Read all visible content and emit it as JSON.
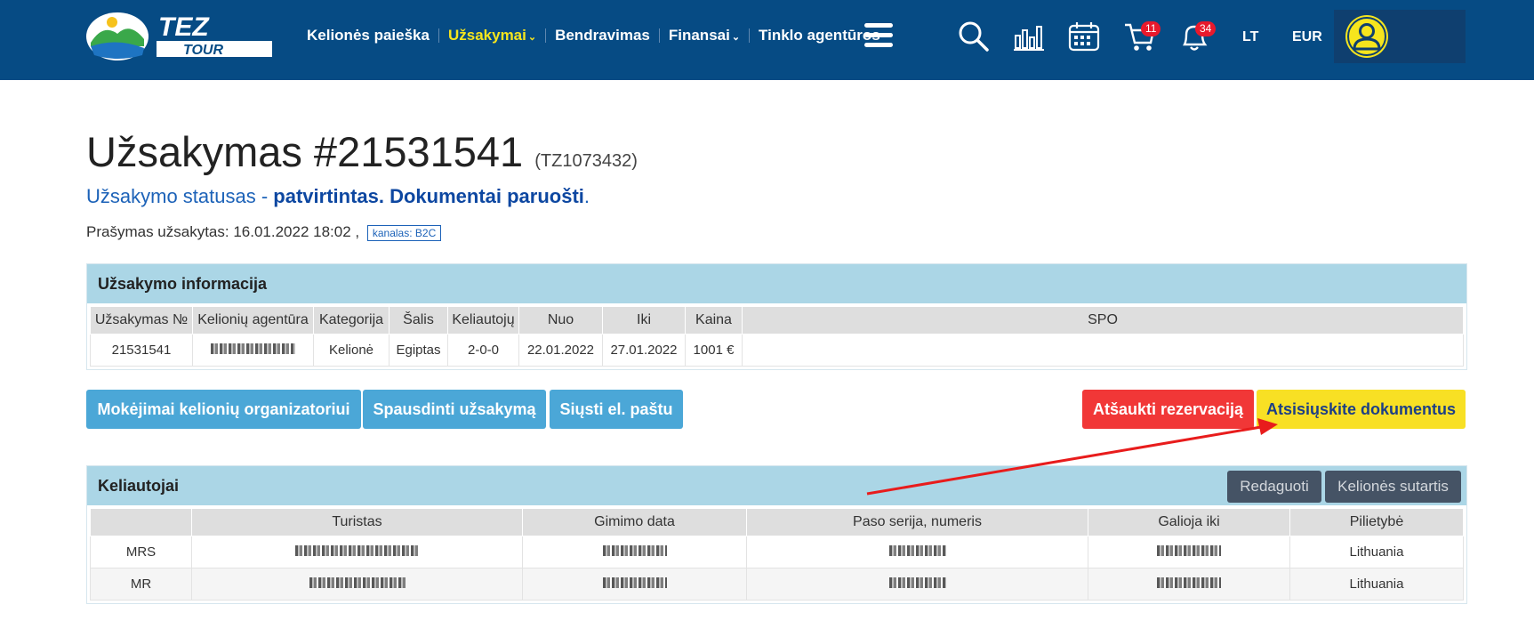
{
  "brand": {
    "name": "TEZ",
    "sub": "TOUR"
  },
  "nav": {
    "search_trips": "Kelionės paieška",
    "orders": "Užsakymai",
    "communication": "Bendravimas",
    "finance": "Finansai",
    "network_agencies": "Tinklo agentūros"
  },
  "top_icons": {
    "cart_badge": "11",
    "bell_badge": "34",
    "lang": "LT",
    "currency": "EUR"
  },
  "order": {
    "title": "Užsakymas #21531541",
    "sub_id": "(TZ1073432)",
    "status_prefix": "Užsakymo statusas - ",
    "status_value": "patvirtintas. Dokumentai paruošti",
    "status_suffix": ".",
    "created": "Prašymas užsakytas: 16.01.2022 18:02 ,",
    "channel": "kanalas: B2C"
  },
  "info_panel": {
    "title": "Užsakymo informacija",
    "columns": [
      "Užsakymas №",
      "Kelionių agentūra",
      "Kategorija",
      "Šalis",
      "Keliautojų",
      "Nuo",
      "Iki",
      "Kaina",
      "SPO"
    ],
    "row": {
      "order_no": "21531541",
      "category": "Kelionė",
      "country": "Egiptas",
      "travelers": "2-0-0",
      "from": "22.01.2022",
      "to": "27.01.2022",
      "price": "1001 €",
      "spo": ""
    }
  },
  "actions": {
    "payments": "Mokėjimai kelionių organizatoriui",
    "print": "Spausdinti užsakymą",
    "email": "Siųsti el. paštu",
    "cancel": "Atšaukti rezervaciją",
    "download": "Atsisiųskite dokumentus"
  },
  "travelers_panel": {
    "title": "Keliautojai",
    "edit": "Redaguoti",
    "contract": "Kelionės sutartis",
    "columns": [
      "",
      "Turistas",
      "Gimimo data",
      "Paso serija, numeris",
      "Galioja iki",
      "Pilietybė"
    ],
    "rows": [
      {
        "title": "MRS",
        "citizenship": "Lithuania"
      },
      {
        "title": "MR",
        "citizenship": "Lithuania"
      }
    ]
  },
  "colors": {
    "topbar": "#064b84",
    "accent_yellow": "#f8e024",
    "cancel_red": "#f13737",
    "action_blue": "#4ba7d7",
    "panel_head": "#abd6e6"
  }
}
